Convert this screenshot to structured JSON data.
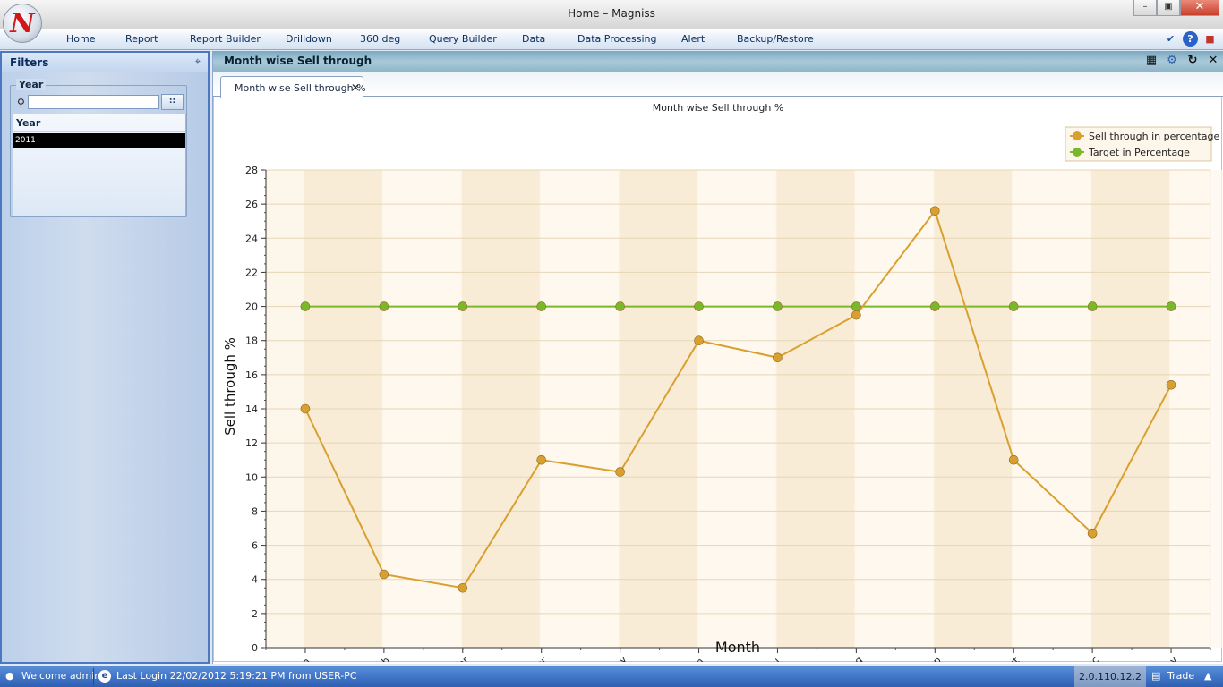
{
  "window": {
    "title": "Home – Magniss",
    "logo_letter": "N",
    "minimize": "–",
    "restore": "▣",
    "close": "✕"
  },
  "menu": {
    "items": [
      "Home",
      "Report",
      "Report Builder",
      "Drilldown",
      "360 deg",
      "Query Builder",
      "Data",
      "Data Processing",
      "Alert",
      "Backup/Restore"
    ],
    "tools": [
      "chevron-down-icon",
      "help-icon",
      "exit-icon"
    ]
  },
  "filters": {
    "title": "Filters",
    "pin": "⌖",
    "group_label": "Year",
    "search_value": "",
    "browse_button": "::",
    "grid_header": "Year",
    "rows": [
      "2011"
    ]
  },
  "report": {
    "title": "Month wise Sell through",
    "tab_label": "Month wise Sell through %",
    "header_icons": [
      "grid-icon",
      "chart-settings-icon",
      "refresh-icon",
      "close-icon"
    ]
  },
  "chart_data": {
    "type": "line",
    "title": "Month wise Sell through %",
    "xlabel": "Month",
    "ylabel": "Sell through %",
    "categories": [
      "Jan",
      "Feb",
      "Mar",
      "Apr",
      "May",
      "Jun",
      "Jul",
      "Aug",
      "Sep",
      "Oct",
      "Dec",
      "Nov"
    ],
    "ylim": [
      0,
      28
    ],
    "yticks": [
      0,
      2,
      4,
      6,
      8,
      10,
      12,
      14,
      16,
      18,
      20,
      22,
      24,
      26,
      28
    ],
    "legend_position": "top-right",
    "grid": true,
    "series": [
      {
        "name": "Sell through in percentage",
        "color": "#d9a030",
        "values": [
          14,
          4.3,
          3.5,
          11,
          10.3,
          18,
          17,
          19.5,
          25.6,
          11,
          6.7,
          15.4
        ]
      },
      {
        "name": "Target in Percentage",
        "color": "#7ab82a",
        "values": [
          20,
          20,
          20,
          20,
          20,
          20,
          20,
          20,
          20,
          20,
          20,
          20
        ]
      }
    ]
  },
  "status": {
    "welcome": "Welcome admin",
    "last_login": "Last Login 22/02/2012 5:19:21 PM  from USER-PC",
    "version": "2.0.110.12.2",
    "mode": "Trade"
  }
}
